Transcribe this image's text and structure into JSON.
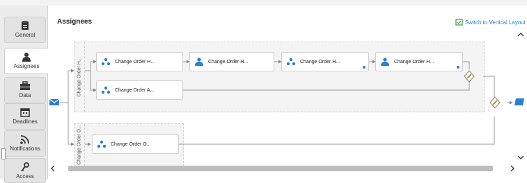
{
  "sidebar": {
    "tabs": [
      {
        "label": "General",
        "icon": "clipboard-icon",
        "active": false
      },
      {
        "label": "Assignees",
        "icon": "person-icon",
        "active": true
      },
      {
        "label": "Data",
        "icon": "briefcase-icon",
        "active": false
      },
      {
        "label": "Deadlines",
        "icon": "calendar-icon",
        "active": false
      },
      {
        "label": "Notifications",
        "icon": "rss-icon",
        "active": false
      },
      {
        "label": "Access",
        "icon": "key-icon",
        "active": false
      }
    ]
  },
  "panel": {
    "title": "Assignees",
    "switch_label": "Switch to Vertical Layout"
  },
  "lanes": [
    {
      "label": "Change Order H..."
    },
    {
      "label": "Change Order O..."
    }
  ],
  "nodes": [
    {
      "label": "Change Order H...",
      "kind": "group"
    },
    {
      "label": "Change Order H...",
      "kind": "user"
    },
    {
      "label": "Change Order H...",
      "kind": "group"
    },
    {
      "label": "Change Order H...",
      "kind": "user"
    },
    {
      "label": "Change Order A...",
      "kind": "group"
    },
    {
      "label": "Change Order O...",
      "kind": "group"
    }
  ],
  "colors": {
    "accent": "#2a7fd4",
    "link": "#2a7fd4"
  }
}
